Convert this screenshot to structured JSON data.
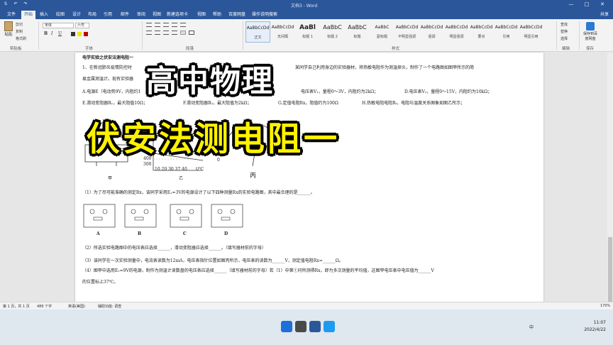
{
  "window": {
    "title": "文档3 - Word",
    "share": "共享"
  },
  "quick_access": {
    "save": "S",
    "undo": "↶",
    "redo": "↷"
  },
  "window_controls": {
    "minimize": "—",
    "maximize": "□",
    "close": "✕"
  },
  "tabs": [
    {
      "label": "文件",
      "active": false
    },
    {
      "label": "开始",
      "active": true
    },
    {
      "label": "插入",
      "active": false
    },
    {
      "label": "绘图",
      "active": false
    },
    {
      "label": "设计",
      "active": false
    },
    {
      "label": "布局",
      "active": false
    },
    {
      "label": "引用",
      "active": false
    },
    {
      "label": "邮件",
      "active": false
    },
    {
      "label": "审阅",
      "active": false
    },
    {
      "label": "视图",
      "active": false
    },
    {
      "label": "新建选项卡",
      "active": false
    },
    {
      "label": "视图",
      "active": false
    },
    {
      "label": "帮助",
      "active": false
    },
    {
      "label": "百度网盘",
      "active": false
    },
    {
      "label": "操作说明搜索",
      "active": false
    }
  ],
  "ribbon": {
    "clipboard": {
      "paste": "粘贴",
      "cut": "剪切",
      "copy": "复制",
      "format_painter": "格式刷",
      "group": "剪贴板"
    },
    "font": {
      "name": "宋体",
      "size": "六号",
      "group": "字体",
      "bold": "B",
      "italic": "I",
      "underline": "U"
    },
    "paragraph": {
      "group": "段落"
    },
    "styles": {
      "group": "样式",
      "items": [
        {
          "preview": "AaBbCcDd",
          "name": "正文",
          "selected": true
        },
        {
          "preview": "AaBbCcDd",
          "name": "无间隔",
          "selected": false
        },
        {
          "preview": "AaBl",
          "name": "标题 1",
          "selected": false
        },
        {
          "preview": "AaBbC",
          "name": "标题 2",
          "selected": false
        },
        {
          "preview": "AaBbC",
          "name": "标题",
          "selected": false
        },
        {
          "preview": "AaBbC",
          "name": "副标题",
          "selected": false
        },
        {
          "preview": "AaBbCcDd",
          "name": "不明显强调",
          "selected": false
        },
        {
          "preview": "AaBbCcDd",
          "name": "强调",
          "selected": false
        },
        {
          "preview": "AaBbCcDd",
          "name": "明显强调",
          "selected": false
        },
        {
          "preview": "AaBbCcDd",
          "name": "要点",
          "selected": false
        },
        {
          "preview": "AaBbCcDd",
          "name": "引用",
          "selected": false
        },
        {
          "preview": "AaBbCcDd",
          "name": "明显引用",
          "selected": false
        }
      ]
    },
    "editing": {
      "find": "查找",
      "replace": "替换",
      "select": "选择",
      "group": "编辑"
    },
    "save": {
      "label": "保存到百度网盘",
      "group": "保存"
    }
  },
  "document": {
    "heading": "电学实验之伏安法测电阻一",
    "q1_line1": "1、在新冠肺炎疫情防控时",
    "q1_line1b": "某同学自己利用身边的实验器材，将热敏电阻作为测温探头，制作了一个电路图如图甲所示的简",
    "q1_line2": "易金属测温计。现有实验器",
    "opt_a": "A.电源E（电动势9V，内阻约1",
    "opt_a2": "电压表V₁，量程0～3V，内阻约为2kΩ；",
    "opt_d": "D.电压表V₂，量程0～15V，内阻约为10kΩ；",
    "opt_e": "E.滑动变阻器R₁，最大阻值10Ω；",
    "opt_f": "F.滑动变阻器R₂，最大阻值为2kΩ；",
    "opt_g": "G.定值电阻Rx，阻值约为100Ω",
    "opt_h": "H.热敏电阻电阻Rₜ，电阻与温度关系图象如图乙所示；",
    "fig_jia": "甲",
    "fig_yi": "乙",
    "fig_bing": "丙",
    "axis_t": "t/℃",
    "axis_ticks": "10 20 30 37 40",
    "y_400": "400",
    "y_300": "300",
    "y_0": "0",
    "q_1": "（1）为了尽可能准确的测定Rx，该同学采用E₁=3V的电源设计了以下四种测量Rx的实验电路图，其中最合理的是______。",
    "circuit_labels": [
      "A",
      "B",
      "C",
      "D"
    ],
    "q_2": "（2）所选实验电路图中的电压表应选择______，滑动变阻器应选择______。（填写器材前的字母）",
    "q_3": "（3）该同学在一次实验测量中，电流表读数为12mA，电压表指针位置如图丙所示，电压表的读数为______V，测定值电阻Rx=______Ω。",
    "q_4a": "（4）图甲中选用E₁=9V的电源，制作为测温计读数盘的电压表应选择______（填写器材前的字母）若（1）中第①问所测得Rx，即为多次测量的平均值，这图甲电压表中电压值为______V",
    "q_4b": "的位置标上37℃。"
  },
  "overlay": {
    "title1": "高中物理",
    "title2": "伏安法测电阻一"
  },
  "status": {
    "page": "第 1 页，共 1 页",
    "words": "486 个字",
    "lang": "英语(美国)",
    "access": "辅助功能: 调查",
    "zoom": "170%"
  },
  "taskbar": {
    "ime": "中",
    "time": "11:07",
    "date": "2022/4/22"
  }
}
